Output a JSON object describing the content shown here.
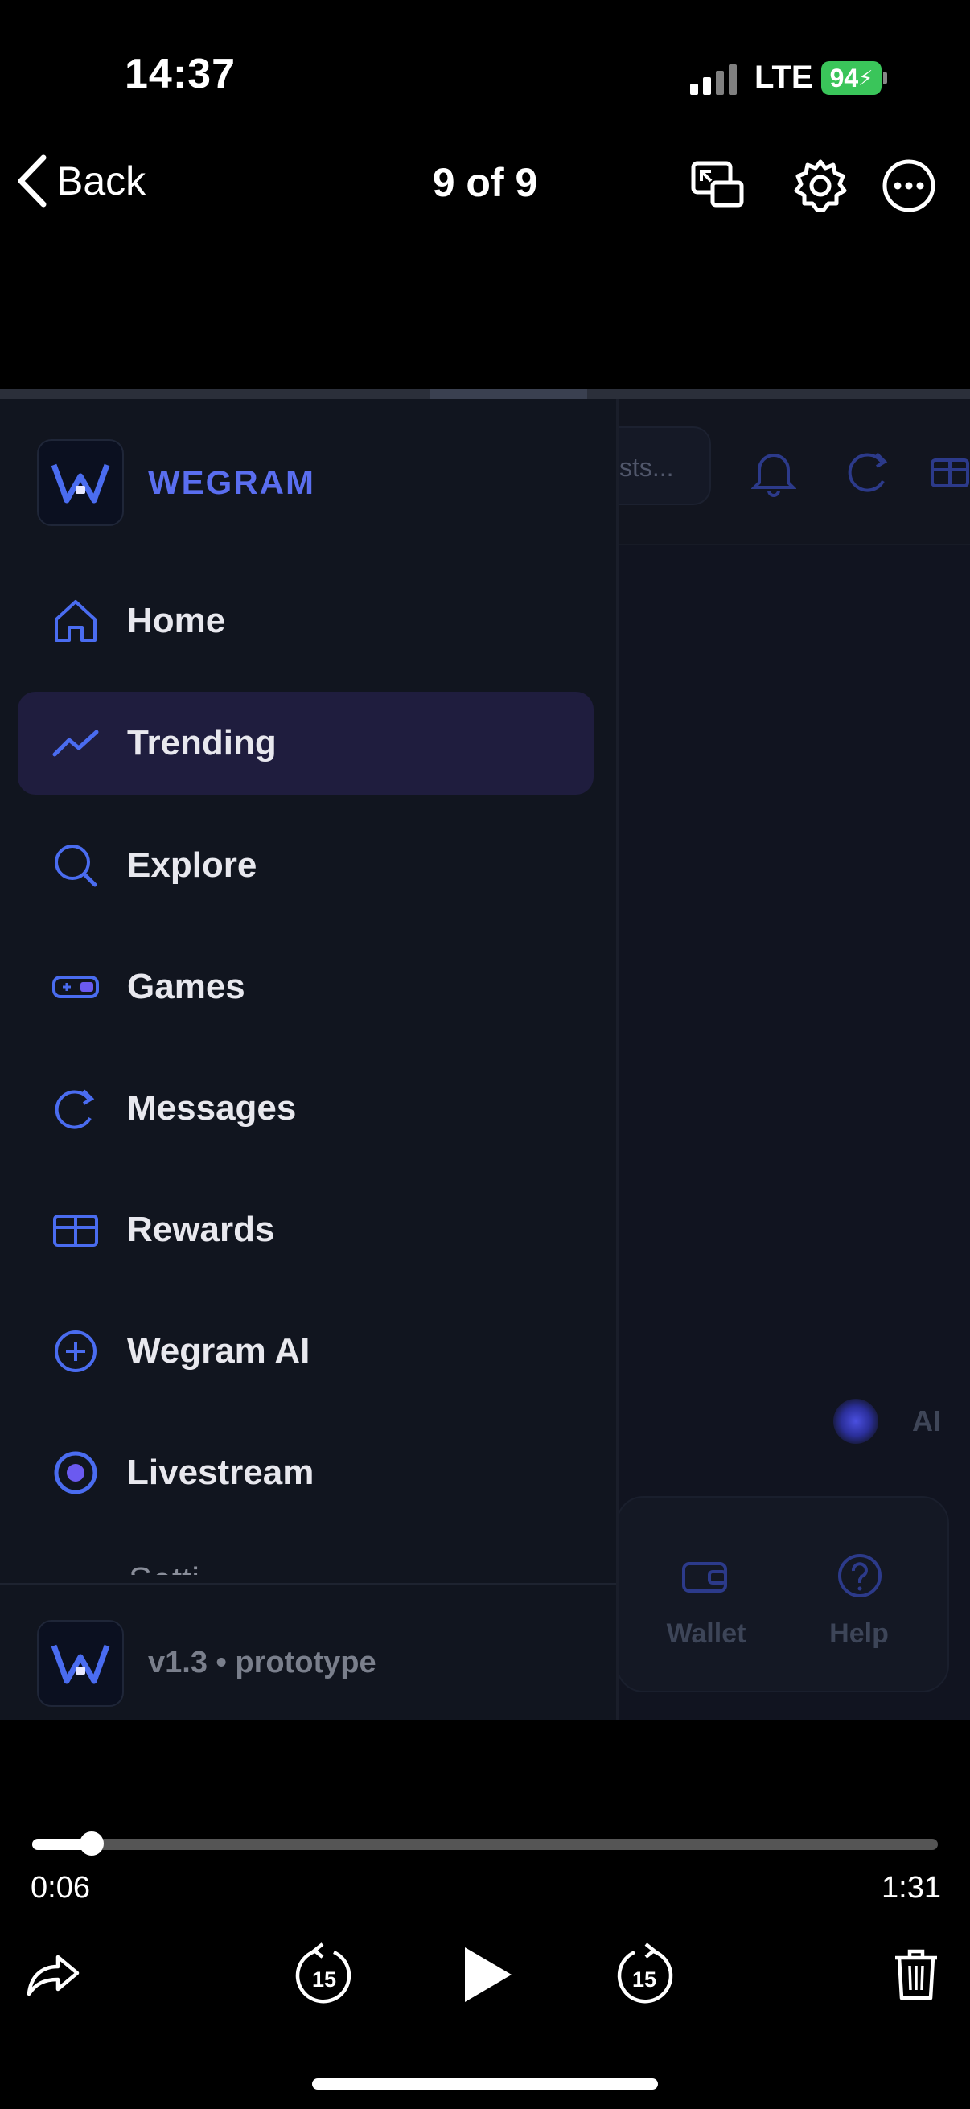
{
  "status_bar": {
    "time": "14:37",
    "network": "LTE",
    "battery": "94"
  },
  "nav": {
    "back_label": "Back",
    "counter": "9 of 9"
  },
  "video": {
    "search_placeholder": "sts...",
    "ai_label": "AI",
    "dock": [
      {
        "label": "Wallet"
      },
      {
        "label": "Help"
      }
    ],
    "sidebar": {
      "brand": "WEGRAM",
      "items": [
        {
          "label": "Home",
          "icon": "home-icon"
        },
        {
          "label": "Trending",
          "icon": "trending-icon",
          "active": true
        },
        {
          "label": "Explore",
          "icon": "search-icon"
        },
        {
          "label": "Games",
          "icon": "gamepad-icon"
        },
        {
          "label": "Messages",
          "icon": "messages-icon"
        },
        {
          "label": "Rewards",
          "icon": "gift-icon"
        },
        {
          "label": "Wegram AI",
          "icon": "plus-circle-icon"
        },
        {
          "label": "Livestream",
          "icon": "record-icon"
        }
      ],
      "partial_item": "Setti",
      "version": "v1.3 • prototype"
    }
  },
  "player": {
    "elapsed": "0:06",
    "duration": "1:31",
    "progress": 0.066,
    "skip_back": "15",
    "skip_forward": "15"
  }
}
